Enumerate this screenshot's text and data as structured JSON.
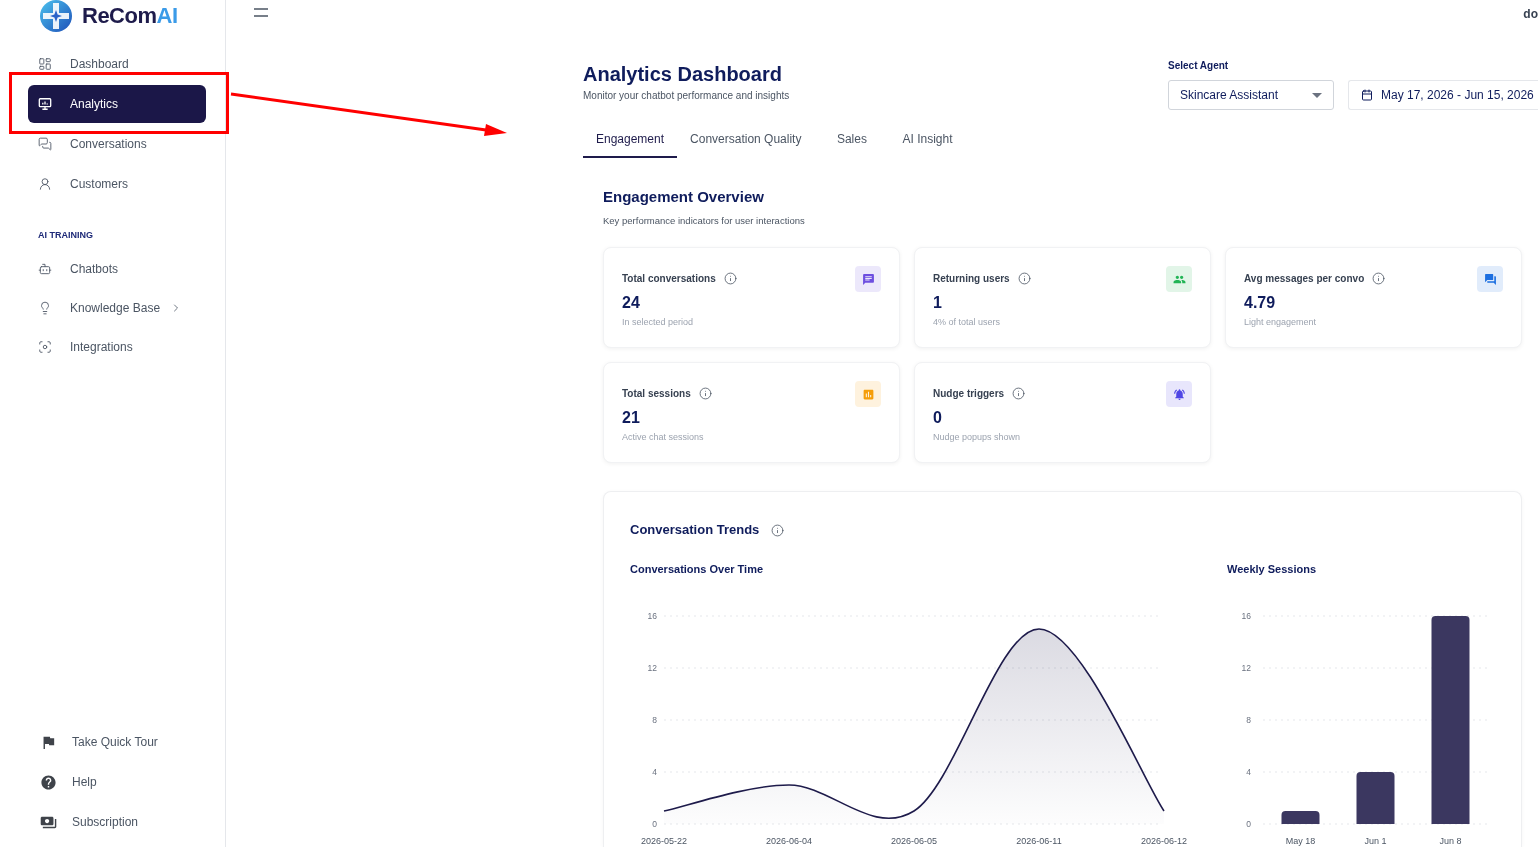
{
  "sidebar": {
    "logo": {
      "name": "ReCom",
      "name_accent": "AI"
    },
    "nav": [
      {
        "label": "Dashboard",
        "kind": "link",
        "selected": false,
        "highlighted": false
      },
      {
        "label": "Analytics",
        "kind": "link",
        "selected": true,
        "highlighted": true
      },
      {
        "label": "Conversations",
        "kind": "link",
        "selected": false,
        "highlighted": false
      },
      {
        "label": "Customers",
        "kind": "link",
        "selected": false,
        "highlighted": false
      }
    ],
    "section_title": "AI TRAINING",
    "training": [
      {
        "label": "Chatbots",
        "kind": "link",
        "selected": false,
        "highlighted": false
      },
      {
        "label": "Knowledge Base",
        "kind": "group",
        "expanded": false,
        "selected": false,
        "highlighted": false
      },
      {
        "label": "Integrations",
        "kind": "link",
        "selected": false,
        "highlighted": false
      }
    ],
    "footer": [
      "Take Quick Tour",
      "Help",
      "Subscription"
    ]
  },
  "header": {
    "user": "do"
  },
  "page": {
    "title": "Analytics Dashboard",
    "subtitle": "Monitor your chatbot performance and insights",
    "agent_select": {
      "label": "Select Agent",
      "value": "Skincare Assistant"
    },
    "date_range": "May 17, 2026 - Jun 15, 2026"
  },
  "tabs": [
    {
      "label": "Engagement",
      "selected": true
    },
    {
      "label": "Conversation Quality",
      "selected": false
    },
    {
      "label": "Sales",
      "selected": false
    },
    {
      "label": "AI Insight",
      "selected": false
    }
  ],
  "overview": {
    "title": "Engagement Overview",
    "subtitle": "Key performance indicators for user interactions",
    "cards": [
      {
        "label": "Total conversations",
        "value": "24",
        "note": "In selected period",
        "color": "#6d4fe0"
      },
      {
        "label": "Returning users",
        "value": "1",
        "note": "4% of total users",
        "color": "#22b455"
      },
      {
        "label": "Avg messages per convo",
        "value": "4.79",
        "note": "Light engagement",
        "color": "#1d6fe0"
      },
      {
        "label": "Total sessions",
        "value": "21",
        "note": "Active chat sessions",
        "color": "#f59e0b"
      },
      {
        "label": "Nudge triggers",
        "value": "0",
        "note": "Nudge popups shown",
        "color": "#4f46e5"
      }
    ]
  },
  "trends": {
    "title": "Conversation Trends",
    "over_time": {
      "chart_data": {
        "type": "area",
        "title": "Conversations Over Time",
        "categories": [
          "2026-05-22",
          "2026-06-04",
          "2026-06-05",
          "2026-06-11",
          "2026-06-12"
        ],
        "values": [
          1,
          3,
          1,
          15,
          1
        ],
        "ylim": [
          0,
          16
        ],
        "yticks": [
          0,
          4,
          8,
          12,
          16
        ],
        "grid": true
      }
    },
    "weekly": {
      "chart_data": {
        "type": "bar",
        "title": "Weekly Sessions",
        "categories": [
          "May 18",
          "Jun 1",
          "Jun 8"
        ],
        "values": [
          1,
          4,
          16
        ],
        "ylim": [
          0,
          16
        ],
        "yticks": [
          0,
          4,
          8,
          12,
          16
        ],
        "grid": true
      }
    }
  }
}
